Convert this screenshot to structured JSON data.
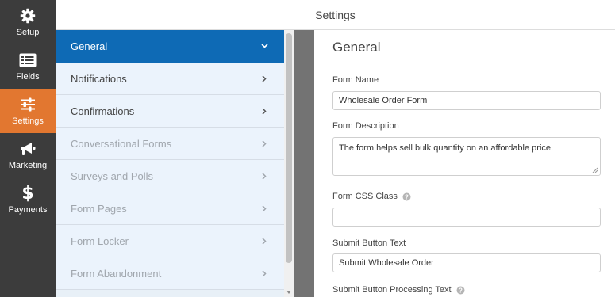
{
  "header": {
    "title": "Settings"
  },
  "sidebar": {
    "items": [
      {
        "label": "Setup",
        "icon": "gear-icon",
        "active": false
      },
      {
        "label": "Fields",
        "icon": "fields-list-icon",
        "active": false
      },
      {
        "label": "Settings",
        "icon": "sliders-icon",
        "active": true
      },
      {
        "label": "Marketing",
        "icon": "megaphone-icon",
        "active": false
      },
      {
        "label": "Payments",
        "icon": "dollar-icon",
        "active": false
      }
    ]
  },
  "panel": {
    "items": [
      {
        "label": "General",
        "state": "active"
      },
      {
        "label": "Notifications",
        "state": "normal"
      },
      {
        "label": "Confirmations",
        "state": "normal"
      },
      {
        "label": "Conversational Forms",
        "state": "disabled"
      },
      {
        "label": "Surveys and Polls",
        "state": "disabled"
      },
      {
        "label": "Form Pages",
        "state": "disabled"
      },
      {
        "label": "Form Locker",
        "state": "disabled"
      },
      {
        "label": "Form Abandonment",
        "state": "disabled"
      }
    ]
  },
  "form": {
    "title": "General",
    "form_name": {
      "label": "Form Name",
      "value": "Wholesale Order Form"
    },
    "form_description": {
      "label": "Form Description",
      "value": "The form helps sell bulk quantity on an affordable price."
    },
    "form_css_class": {
      "label": "Form CSS Class",
      "value": ""
    },
    "submit_text": {
      "label": "Submit Button Text",
      "value": "Submit Wholesale Order"
    },
    "processing_text": {
      "label": "Submit Button Processing Text"
    }
  },
  "colors": {
    "accent": "#e27730",
    "active_panel": "#0e6ab5",
    "sidebar_bg": "#3c3c3c"
  }
}
